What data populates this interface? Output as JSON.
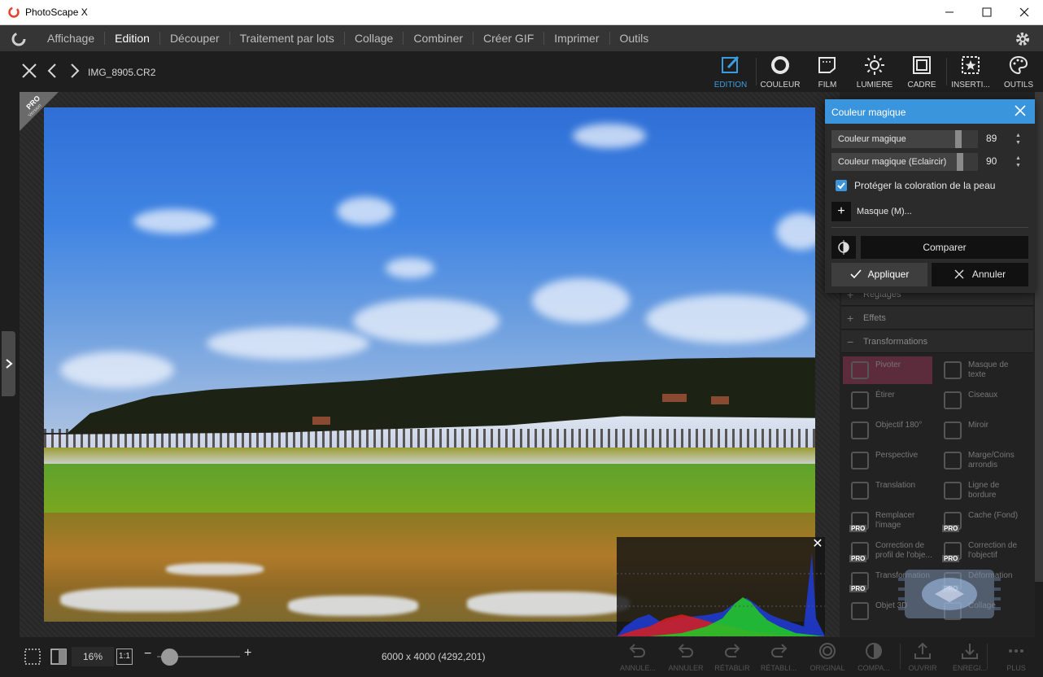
{
  "window": {
    "title": "PhotoScape X"
  },
  "menu": {
    "items": [
      "Affichage",
      "Edition",
      "Découper",
      "Traitement par lots",
      "Collage",
      "Combiner",
      "Créer GIF",
      "Imprimer",
      "Outils"
    ],
    "active": "Edition"
  },
  "toolbar": {
    "filename": "IMG_8905.CR2",
    "tools": [
      {
        "label": "EDITION",
        "icon": "edit-icon",
        "active": true
      },
      {
        "label": "COULEUR",
        "icon": "color-circle-icon",
        "active": false
      },
      {
        "label": "FILM",
        "icon": "film-icon",
        "active": false
      },
      {
        "label": "LUMIÈRE",
        "icon": "sun-icon",
        "active": false
      },
      {
        "label": "CADRE",
        "icon": "frame-icon",
        "active": false
      },
      {
        "label": "INSERTI...",
        "icon": "insert-star-icon",
        "active": false
      },
      {
        "label": "OUTILS",
        "icon": "palette-icon",
        "active": false
      }
    ]
  },
  "pro_badge": {
    "line1": "PRO",
    "line2": "Version"
  },
  "popup": {
    "title": "Couleur magique",
    "sliders": [
      {
        "label": "Couleur magique",
        "value": "89",
        "fraction": 0.89
      },
      {
        "label": "Couleur magique (Eclaircir)",
        "value": "90",
        "fraction": 0.9
      }
    ],
    "checkbox_label": "Protéger la coloration de la peau",
    "checkbox_checked": true,
    "mask_label": "Masque (M)...",
    "compare_label": "Comparer",
    "apply_label": "Appliquer",
    "cancel_label": "Annuler"
  },
  "right_panel": {
    "sections": [
      {
        "label": "Réglages",
        "expanded": false
      },
      {
        "label": "Effets",
        "expanded": false
      },
      {
        "label": "Transformations",
        "expanded": true
      }
    ],
    "tools": [
      {
        "label": "Pivoter",
        "pro": false
      },
      {
        "label": "Masque de texte",
        "pro": false
      },
      {
        "label": "Étirer",
        "pro": false
      },
      {
        "label": "Ciseaux",
        "pro": false
      },
      {
        "label": "Objectif 180°",
        "pro": false
      },
      {
        "label": "Miroir",
        "pro": false
      },
      {
        "label": "Perspective",
        "pro": false
      },
      {
        "label": "Marge/Coins arrondis",
        "pro": false
      },
      {
        "label": "Translation",
        "pro": false
      },
      {
        "label": "Ligne de bordure",
        "pro": false
      },
      {
        "label": "Remplacer l'image",
        "pro": true
      },
      {
        "label": "Cache (Fond)",
        "pro": true
      },
      {
        "label": "Correction de profil de l'obje...",
        "pro": true
      },
      {
        "label": "Correction de l'objectif",
        "pro": true
      },
      {
        "label": "Transformation",
        "pro": true
      },
      {
        "label": "Déformation",
        "pro": true
      },
      {
        "label": "Objet 3D",
        "pro": false
      },
      {
        "label": "Collage",
        "pro": false
      }
    ],
    "pro_tag": "PRO"
  },
  "bottom": {
    "zoom": "16%",
    "one_to_one": "1:1",
    "dimensions": "6000 x 4000 (4292,201)",
    "minus": "−",
    "plus": "+",
    "buttons": [
      {
        "label": "ANNULE...",
        "icon": "undo-all-icon"
      },
      {
        "label": "ANNULER",
        "icon": "undo-icon"
      },
      {
        "label": "RÉTABLIR",
        "icon": "redo-icon"
      },
      {
        "label": "RÉTABLI...",
        "icon": "redo-all-icon"
      },
      {
        "label": "ORIGINAL",
        "icon": "original-icon"
      },
      {
        "label": "COMPA...",
        "icon": "compare-icon"
      },
      {
        "label": "OUVRIR",
        "icon": "open-icon"
      },
      {
        "label": "ENREGI...",
        "icon": "save-icon"
      },
      {
        "label": "PLUS",
        "icon": "more-icon"
      }
    ]
  },
  "colors": {
    "accent": "#3b95dc",
    "menubar": "#353535",
    "background": "#1e1e1e"
  }
}
